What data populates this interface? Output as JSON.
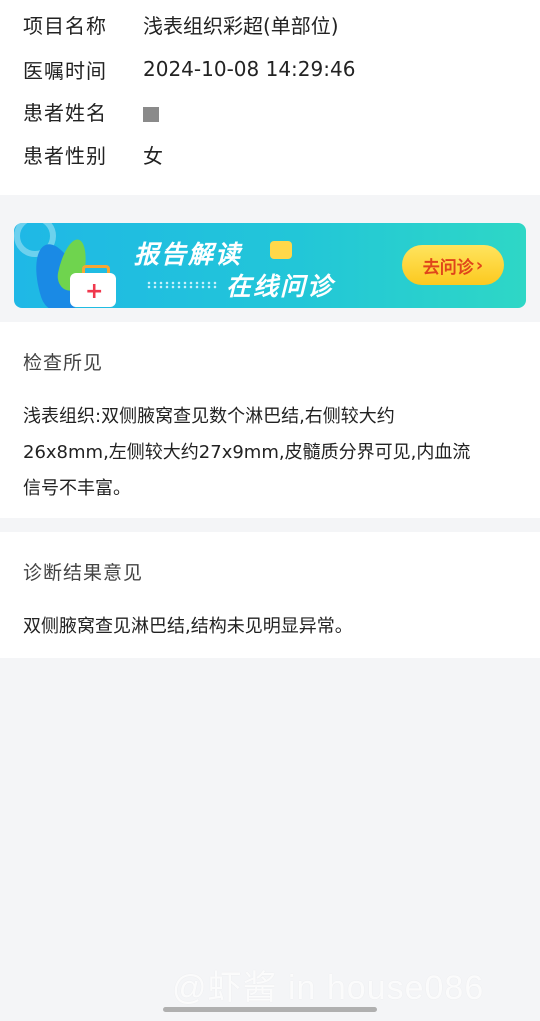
{
  "info": {
    "rows": [
      {
        "label": "项目名称",
        "value": "浅表组织彩超(单部位)"
      },
      {
        "label": "医嘱时间",
        "value": "2024-10-08 14:29:46"
      },
      {
        "label": "患者姓名",
        "value": ""
      },
      {
        "label": "患者性别",
        "value": "女"
      }
    ]
  },
  "banner": {
    "line1": "报告解读",
    "line2": "在线问诊",
    "button": "去问诊",
    "button_chevron": "›"
  },
  "findings": {
    "title": "检查所见",
    "lines": [
      "浅表组织:双侧腋窝查见数个淋巴结,右侧较大约",
      "26x8mm,左侧较大约27x9mm,皮髓质分界可见,内血流",
      "信号不丰富。"
    ]
  },
  "diagnosis": {
    "title": "诊断结果意见",
    "text": "双侧腋窝查见淋巴结,结构未见明显异常。"
  },
  "watermark": "@虾酱 in house086",
  "colors": {
    "banner_start": "#1fb8e6",
    "banner_end": "#2ed7c6",
    "button_text": "#e0451a",
    "button_bg": "#fcc91f"
  }
}
